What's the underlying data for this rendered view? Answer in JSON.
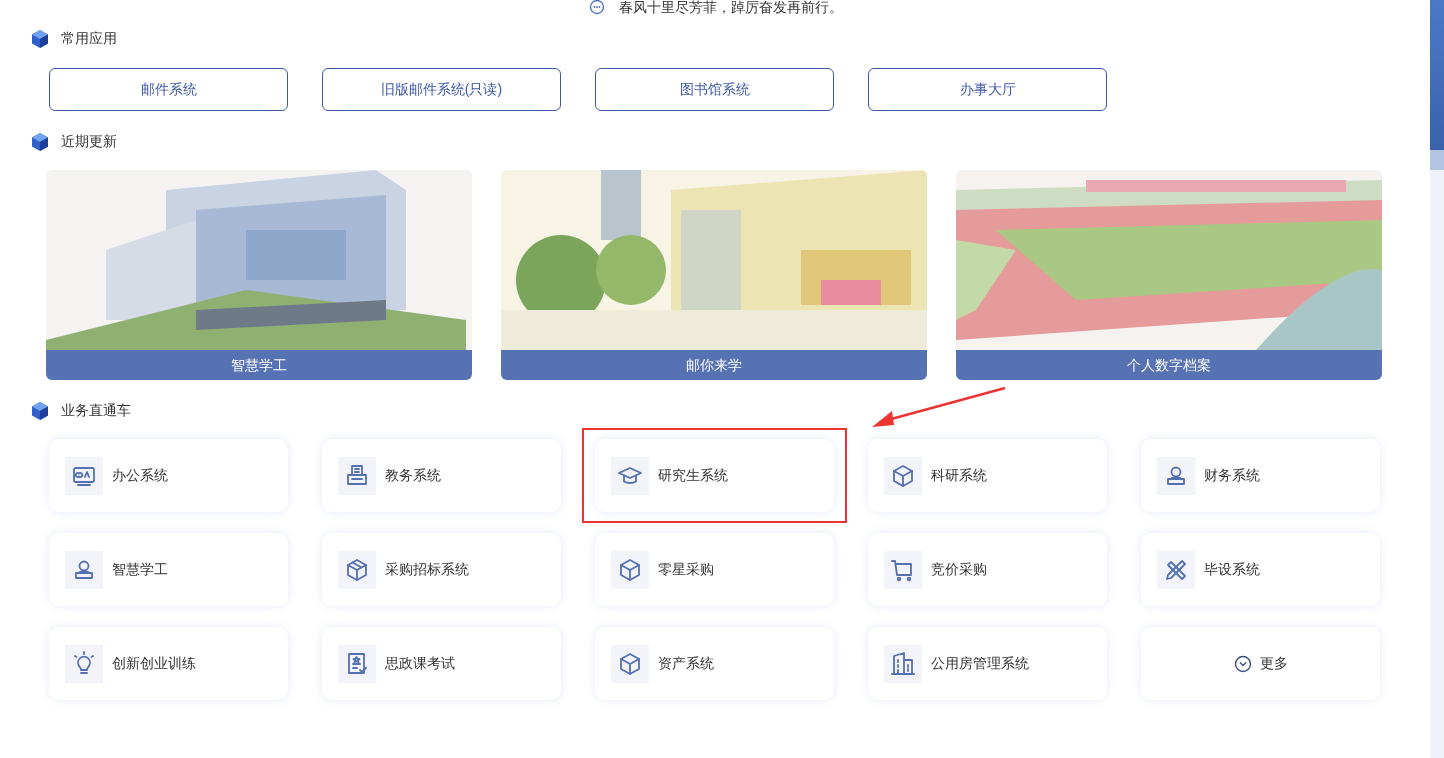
{
  "banner": {
    "text": "春风十里尽芳菲，踔厉奋发再前行。"
  },
  "sections": [
    {
      "title": "常用应用",
      "kind": "links",
      "items": [
        {
          "label": "邮件系统"
        },
        {
          "label": "旧版邮件系统(只读)"
        },
        {
          "label": "图书馆系统"
        },
        {
          "label": "办事大厅"
        }
      ]
    },
    {
      "title": "近期更新",
      "kind": "pictures",
      "items": [
        {
          "label": "智慧学工",
          "kind": "picture"
        },
        {
          "label": "邮你来学",
          "kind": "picture"
        },
        {
          "label": "个人数字档案",
          "kind": "picture"
        }
      ]
    },
    {
      "title": "业务直通车",
      "kind": "apps",
      "items": [
        {
          "label": "办公系统",
          "kind": "app",
          "highlighted": false
        },
        {
          "label": "教务系统",
          "kind": "app",
          "highlighted": false
        },
        {
          "label": "研究生系统",
          "kind": "app",
          "highlighted": true
        },
        {
          "label": "科研系统",
          "kind": "app",
          "highlighted": false
        },
        {
          "label": "财务系统",
          "kind": "app",
          "highlighted": false
        },
        {
          "label": "智慧学工",
          "kind": "app",
          "highlighted": false
        },
        {
          "label": "采购招标系统",
          "kind": "app",
          "highlighted": false
        },
        {
          "label": "零星采购",
          "kind": "app",
          "highlighted": false
        },
        {
          "label": "竞价采购",
          "kind": "app",
          "highlighted": false
        },
        {
          "label": "毕设系统",
          "kind": "app",
          "highlighted": false
        },
        {
          "label": "创新创业训练",
          "kind": "app",
          "highlighted": false
        },
        {
          "label": "思政课考试",
          "kind": "app",
          "highlighted": false
        },
        {
          "label": "资产系统",
          "kind": "app",
          "highlighted": false
        },
        {
          "label": "公用房管理系统",
          "kind": "app",
          "highlighted": false
        },
        {
          "label": "更多",
          "kind": "more",
          "highlighted": false
        }
      ]
    }
  ]
}
